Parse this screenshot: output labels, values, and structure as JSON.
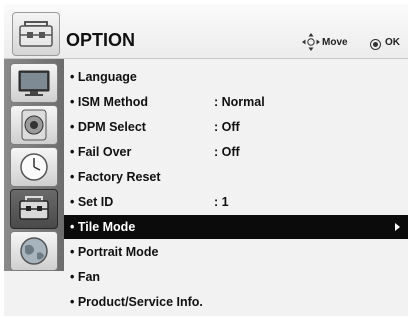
{
  "header": {
    "title": "OPTION",
    "move_label": "Move",
    "ok_label": "OK",
    "icon": "toolbox-icon"
  },
  "sidebar": {
    "items": [
      {
        "name": "picture",
        "icon": "monitor-icon"
      },
      {
        "name": "audio",
        "icon": "speaker-icon"
      },
      {
        "name": "time",
        "icon": "clock-icon"
      },
      {
        "name": "option",
        "icon": "toolbox-icon",
        "active": true
      },
      {
        "name": "network",
        "icon": "globe-icon"
      }
    ]
  },
  "menu": {
    "items": [
      {
        "label": "• Language",
        "value": ""
      },
      {
        "label": "• ISM Method",
        "value": ": Normal"
      },
      {
        "label": "• DPM Select",
        "value": ": Off"
      },
      {
        "label": "• Fail Over",
        "value": ": Off"
      },
      {
        "label": "• Factory Reset",
        "value": ""
      },
      {
        "label": "• Set ID",
        "value": ": 1"
      },
      {
        "label": "• Tile Mode",
        "value": "",
        "selected": true
      },
      {
        "label": "• Portrait Mode",
        "value": ""
      },
      {
        "label": "• Fan",
        "value": ""
      },
      {
        "label": "• Product/Service Info.",
        "value": ""
      }
    ]
  },
  "colors": {
    "selected_bg": "#0b0b0b",
    "panel_bg": "#f2f2f2",
    "sidebar_bg": "#7a7a7a"
  }
}
